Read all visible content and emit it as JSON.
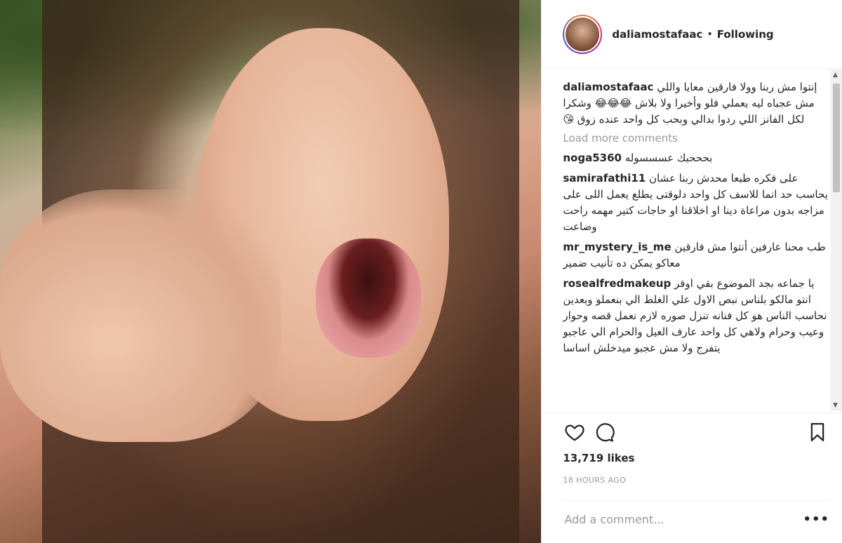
{
  "post": {
    "username": "daliamostafaac",
    "follow_status": "Following",
    "caption": {
      "username": "daliamostafaac",
      "text": "إنتوا مش ربنا وولا فارقين معايا واللي مش عجباه ليه يعملي فلو وأخيرا ولا بلاش 😂😂😂 وشكرا لكل الفانز اللي ردوا بدالي وبحب كل واحد عنده زوق 😘"
    },
    "load_more_label": "Load more comments",
    "comments": [
      {
        "username": "noga5360",
        "text": "بحححبك عسسسوله"
      },
      {
        "username": "samirafathi11",
        "text": "على فكره طبعا محدش ربنا عشان يحاسب حد انما للاسف كل واحد دلوقتى يطلع يعمل اللى على مزاجه بدون مراعاة دينا او اخلاقنا او حاجات كتير مهمه راحت وضاعت"
      },
      {
        "username": "mr_mystery_is_me",
        "text": "طب محنا عارفين أنتوا مش فارقين معاكو يمكن ده تأنيب ضمير"
      },
      {
        "username": "rosealfredmakeup",
        "text": "يا جماعه بجد الموضوع بقي اوفر انتو مالكو بلناس نبص الاول علي الغلط الي بنعملو وبعدين نحاسب الناس هو كل فنانه تنزل صوره لازم نعمل قصه وحوار وعيب وحرام ولاهي كل واحد عارف العيل والحرام الي عاجبو يتفرج ولا مش عجبو ميدخلش اساسا"
      }
    ],
    "likes": "13,719 likes",
    "timestamp": "18 HOURS AGO",
    "add_comment_placeholder": "Add a comment...",
    "more_options": "•••",
    "scroll_up": "▲",
    "scroll_down": "▼"
  },
  "icons": {
    "like": "heart-icon",
    "comment": "comment-icon",
    "save": "bookmark-icon"
  }
}
